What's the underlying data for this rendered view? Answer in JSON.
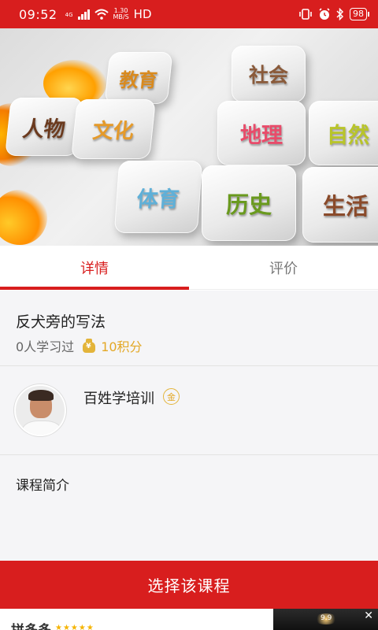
{
  "status_bar": {
    "time": "09:52",
    "network": "4G",
    "speed_value": "1.30",
    "speed_unit": "MB/S",
    "hd": "HD",
    "battery": "98",
    "icons": [
      "signal-icon",
      "wifi-icon",
      "vibrate-icon",
      "alarm-icon",
      "bluetooth-icon",
      "battery-icon"
    ]
  },
  "banner": {
    "tiles": [
      "教育",
      "社会",
      "人物",
      "文化",
      "地理",
      "自然",
      "体育",
      "历史",
      "生活"
    ]
  },
  "tabs": [
    {
      "label": "详情",
      "active": true
    },
    {
      "label": "评价",
      "active": false
    }
  ],
  "course": {
    "title": "反犬旁的写法",
    "learners": "0人学习过",
    "points": "10积分"
  },
  "teacher": {
    "name": "百姓学培训",
    "badge": "金"
  },
  "intro": {
    "label": "课程简介"
  },
  "actions": {
    "select_label": "选择该课程"
  },
  "ad": {
    "brand": "拼多多",
    "stars": "★★★★★",
    "thumb_number": "9.9",
    "close": "✕"
  },
  "colors": {
    "accent": "#d81e1e",
    "gold": "#e3a826",
    "background": "#f5f5f7"
  }
}
